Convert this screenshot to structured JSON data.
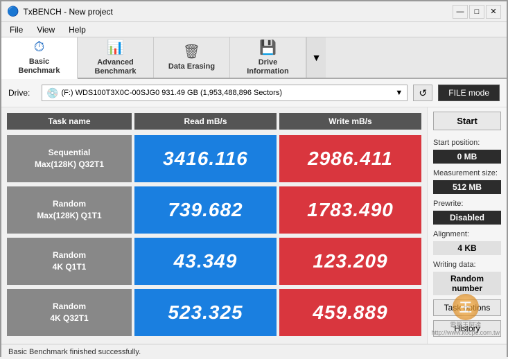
{
  "window": {
    "title": "TxBENCH - New project",
    "controls": {
      "minimize": "—",
      "maximize": "□",
      "close": "✕"
    }
  },
  "menu": {
    "items": [
      "File",
      "View",
      "Help"
    ]
  },
  "toolbar": {
    "tabs": [
      {
        "id": "basic",
        "icon": "⏱",
        "label": "Basic\nBenchmark",
        "active": true
      },
      {
        "id": "advanced",
        "icon": "📊",
        "label": "Advanced\nBenchmark",
        "active": false
      },
      {
        "id": "erasing",
        "icon": "🗑",
        "label": "Data Erasing",
        "active": false
      },
      {
        "id": "drive-info",
        "icon": "💾",
        "label": "Drive\nInformation",
        "active": false
      }
    ],
    "dropdown_icon": "▼"
  },
  "drive": {
    "label": "Drive:",
    "value": "(F:) WDS100T3X0C-00SJG0  931.49 GB (1,953,488,896 Sectors)",
    "refresh_icon": "↺",
    "file_mode_label": "FILE mode"
  },
  "table": {
    "headers": [
      "Task name",
      "Read mB/s",
      "Write mB/s"
    ],
    "rows": [
      {
        "label": "Sequential\nMax(128K) Q32T1",
        "read": "3416.116",
        "write": "2986.411"
      },
      {
        "label": "Random\nMax(128K) Q1T1",
        "read": "739.682",
        "write": "1783.490"
      },
      {
        "label": "Random\n4K Q1T1",
        "read": "43.349",
        "write": "123.209"
      },
      {
        "label": "Random\n4K Q32T1",
        "read": "523.325",
        "write": "459.889"
      }
    ]
  },
  "right_panel": {
    "start_label": "Start",
    "start_position_label": "Start position:",
    "start_position_value": "0 MB",
    "measurement_size_label": "Measurement size:",
    "measurement_size_value": "512 MB",
    "prewrite_label": "Prewrite:",
    "prewrite_value": "Disabled",
    "alignment_label": "Alignment:",
    "alignment_value": "4 KB",
    "writing_data_label": "Writing data:",
    "writing_data_value": "Random number",
    "task_options_label": "Task options",
    "history_label": "History"
  },
  "status_bar": {
    "text": "Basic Benchmark finished successfully."
  },
  "watermark": {
    "logo": "王",
    "line1": "電腦王阿達",
    "line2": "http://www.kocpc.com.tw"
  }
}
